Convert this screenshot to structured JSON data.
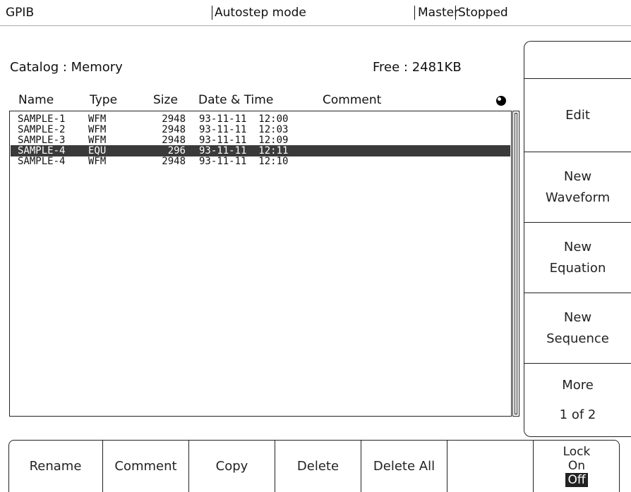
{
  "status_bar": {
    "interface": "GPIB",
    "mode": "Autostep mode",
    "role": "Master",
    "state": "Stopped"
  },
  "catalog": {
    "title": "Catalog : Memory",
    "free": "Free : 2481KB"
  },
  "columns": {
    "name": "Name",
    "type": "Type",
    "size": "Size",
    "datetime": "Date & Time",
    "comment": "Comment"
  },
  "files": [
    {
      "name": "SAMPLE-1",
      "type": "WFM",
      "size": "2948",
      "datetime": "93-11-11  12:00",
      "selected": false
    },
    {
      "name": "SAMPLE-2",
      "type": "WFM",
      "size": "2948",
      "datetime": "93-11-11  12:03",
      "selected": false
    },
    {
      "name": "SAMPLE-3",
      "type": "WFM",
      "size": "2948",
      "datetime": "93-11-11  12:09",
      "selected": false
    },
    {
      "name": "SAMPLE-4",
      "type": "EQU",
      "size": "296",
      "datetime": "93-11-11  12:11",
      "selected": true
    },
    {
      "name": "SAMPLE-4",
      "type": "WFM",
      "size": "2948",
      "datetime": "93-11-11  12:10",
      "selected": false
    }
  ],
  "side_menu": {
    "edit": "Edit",
    "new_waveform_1": "New",
    "new_waveform_2": "Waveform",
    "new_equation_1": "New",
    "new_equation_2": "Equation",
    "new_sequence_1": "New",
    "new_sequence_2": "Sequence",
    "more": "More",
    "page": "1 of 2"
  },
  "bottom_menu": {
    "rename": "Rename",
    "comment": "Comment",
    "copy": "Copy",
    "delete": "Delete",
    "delete_all": "Delete All",
    "lock": "Lock",
    "lock_on": "On",
    "lock_off": "Off"
  }
}
